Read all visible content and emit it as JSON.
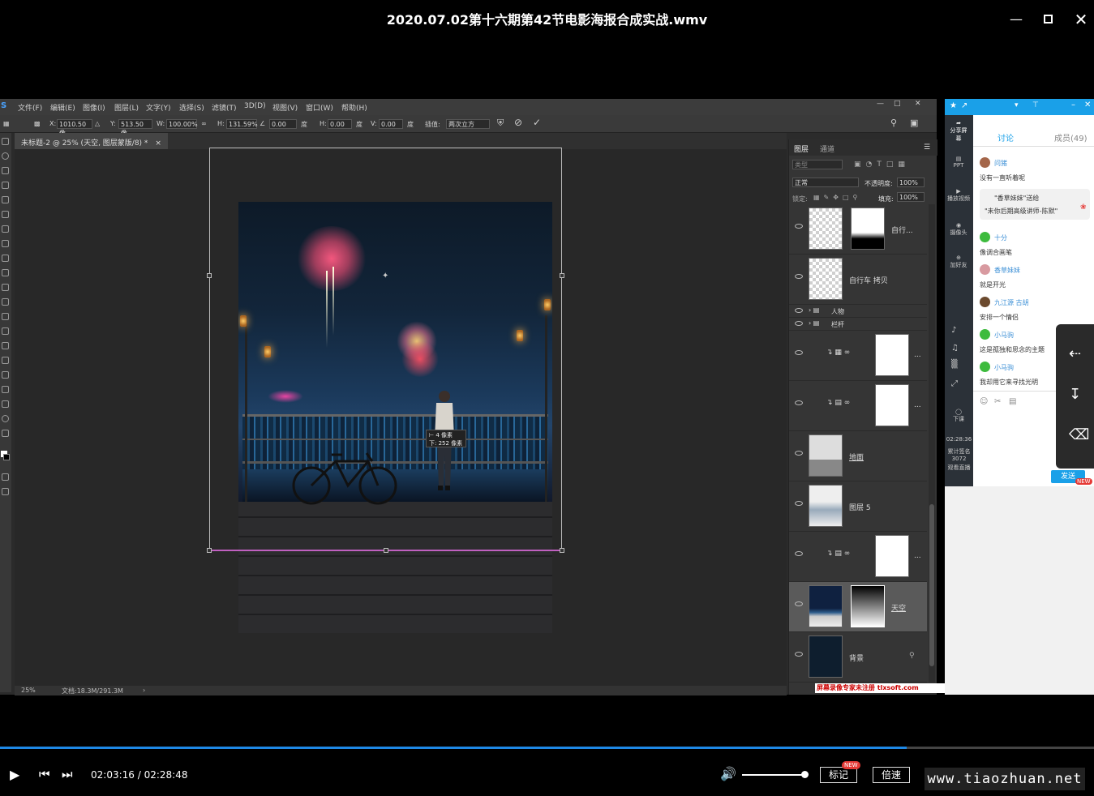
{
  "window": {
    "title": "2020.07.02第十六期第42节电影海报合成实战.wmv"
  },
  "photoshop": {
    "logo": "S",
    "menu": [
      "文件(F)",
      "编辑(E)",
      "图像(I)",
      "图层(L)",
      "文字(Y)",
      "选择(S)",
      "滤镜(T)",
      "3D(D)",
      "视图(V)",
      "窗口(W)",
      "帮助(H)"
    ],
    "options": {
      "x_label": "X:",
      "x_value": "1010.50 像",
      "y_label": "Y:",
      "y_value": "513.50 像",
      "w_label": "W:",
      "w_value": "100.00%",
      "h_label": "H:",
      "h_value": "131.59%",
      "angle_value": "0.00",
      "angle_unit": "度",
      "hskew_label": "H:",
      "hskew_value": "0.00",
      "hskew_unit": "度",
      "vskew_label": "V:",
      "vskew_value": "0.00",
      "vskew_unit": "度",
      "interp_label": "插值:",
      "interp_value": "两次立方"
    },
    "doc_tab": "未标题-2 @ 25% (天空, 图层蒙版/8) *",
    "doc_tab_close": "×",
    "tooltip_line1": "⊢  4 像素",
    "tooltip_line2": "下: 252 像素",
    "status": {
      "zoom": "25%",
      "doc": "文档:18.3M/291.3M",
      "arrow": "›"
    }
  },
  "layers_panel": {
    "tabs": [
      "图层",
      "通道"
    ],
    "search_placeholder": "类型",
    "blend_mode": "正常",
    "opacity_label": "不透明度:",
    "opacity_value": "100%",
    "lock_label": "锁定:",
    "fill_label": "填充:",
    "fill_value": "100%",
    "layers": [
      {
        "name": "自行...",
        "type": "masked"
      },
      {
        "name": "自行车 拷贝",
        "type": "plain"
      },
      {
        "name": "人物",
        "type": "group"
      },
      {
        "name": "栏杆",
        "type": "group"
      },
      {
        "name": "...",
        "type": "adjustment"
      },
      {
        "name": "...",
        "type": "adjustment"
      },
      {
        "name": "地面",
        "type": "plain"
      },
      {
        "name": "图层 5",
        "type": "plain"
      },
      {
        "name": "...",
        "type": "adjustment"
      },
      {
        "name": "天空",
        "type": "masked_selected"
      },
      {
        "name": "背景",
        "type": "background"
      }
    ]
  },
  "chat": {
    "side_items": [
      "分享屏幕",
      "PPT",
      "播放视频",
      "摄像头",
      "加好友",
      "下课",
      "02:28:36",
      "累计签名",
      "3072",
      "观看直播"
    ],
    "tabs": [
      "讨论",
      "成员(49)"
    ],
    "messages": [
      {
        "user": "问猪",
        "text": "没有一直听着呢"
      },
      {
        "user": "",
        "text": "\"香草妹妹\"送给"
      },
      {
        "user": "",
        "text": "\"未你后期高级讲师-陈默\""
      },
      {
        "user": "十分",
        "text": "像调合画笔"
      },
      {
        "user": "香草妹妹",
        "text": "就是开光"
      },
      {
        "user": "九江源 古胡",
        "text": "安排一个情侣"
      },
      {
        "user": "小马驹",
        "text": "这是孤独和思念的主题"
      },
      {
        "user": "小马驹",
        "text": "我却用它来寻找光明"
      }
    ],
    "send_label": "发送",
    "new_badge": "NEW"
  },
  "watermark_ad": "屏幕录像专家未注册 tlxsoft.com",
  "player": {
    "current_time": "02:03:16",
    "separator": " / ",
    "total_time": "02:28:48",
    "progress": 0.829,
    "volume": 1.0,
    "mark_label": "标记",
    "mark_badge": "NEW",
    "speed_label": "倍速",
    "site": "www.tiaozhuan.net"
  }
}
